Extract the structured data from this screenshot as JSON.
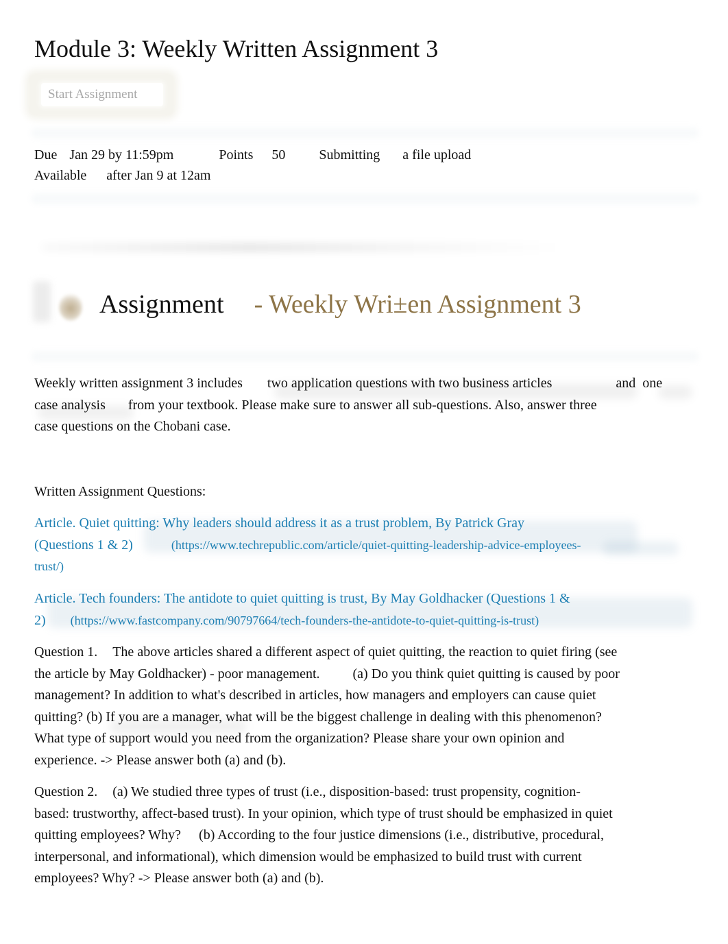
{
  "page": {
    "title": "Module 3: Weekly Written Assignment 3",
    "start_button_label": "Start Assignment"
  },
  "details": {
    "due_label": "Due",
    "due_value": "Jan 29 by 11:59pm",
    "points_label": "Points",
    "points_value": "50",
    "submitting_label": "Submitting",
    "submitting_value": "a file upload",
    "available_label": "Available",
    "available_value": "after Jan 9 at 12am"
  },
  "section": {
    "heading_label": "Assignment",
    "heading_accent": "- Weekly Wri±en Assignment 3",
    "accent_color": "#8d7447"
  },
  "intro": {
    "part1": "Weekly written assignment 3 includes",
    "part2": "two application questions with two business articles",
    "part3": "and",
    "part4": "one",
    "part5": "case analysis",
    "part6": "from your textbook. Please make sure to answer all sub-questions. Also, answer three",
    "part7": "case questions on the Chobani case."
  },
  "questions_heading": "Written Assignment Questions:",
  "articles": [
    {
      "title_line1": "Article. Quiet quitting: Why leaders should address it as a trust problem, By Patrick Gray",
      "title_line2": "(Questions 1 & 2)",
      "url_line1": "(https://www.techrepublic.com/article/quiet-quitting-leadership-advice-employees-",
      "url_line2": "trust/)"
    },
    {
      "title_line1": "Article. Tech founders: The antidote to quiet quitting is trust, By May Goldhacker (Questions 1 &",
      "title_line2": "2)",
      "url_line1": "(https://www.fastcompany.com/90797664/tech-founders-the-antidote-to-quiet-quitting-is-trust)"
    }
  ],
  "link_color": "#1d7fb3",
  "question1": {
    "label": "Question 1.",
    "lines": [
      "The above articles shared a different aspect of quiet quitting, the reaction to quiet firing (see",
      "the article by May Goldhacker) - poor management.",
      "(a)  Do you think quiet quitting is caused by poor",
      "management? In addition to what's described in articles, how managers and employers can cause quiet",
      "quitting?  (b)  If you are a manager, what will be the biggest challenge in dealing with this phenomenon?",
      "What type of support would you need from the organization? Please share your own opinion and",
      "experience. -> Please answer both (a) and (b)."
    ]
  },
  "question2": {
    "label": "Question 2.",
    "lines": [
      "(a)  We studied three types of trust (i.e., disposition-based: trust propensity, cognition-",
      "based: trustworthy, affect-based trust). In your opinion, which type of trust should be emphasized in quiet",
      "quitting employees? Why?",
      "(b)  According to the four justice dimensions (i.e., distributive, procedural,",
      "interpersonal, and informational), which dimension would be emphasized to build trust with current",
      "employees? Why? -> Please answer both (a) and (b)."
    ]
  }
}
